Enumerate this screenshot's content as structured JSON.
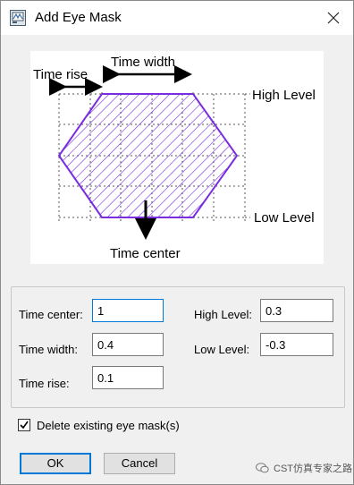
{
  "window": {
    "title": "Add Eye Mask"
  },
  "diagram": {
    "time_rise": "Time rise",
    "time_width": "Time width",
    "high_level": "High Level",
    "low_level": "Low Level",
    "time_center": "Time center",
    "mask_color": "#7a2ce0"
  },
  "fields": {
    "time_center": {
      "label": "Time center:",
      "value": "1"
    },
    "time_width": {
      "label": "Time width:",
      "value": "0.4"
    },
    "time_rise": {
      "label": "Time rise:",
      "value": "0.1"
    },
    "high_level": {
      "label": "High Level:",
      "value": "0.3"
    },
    "low_level": {
      "label": "Low Level:",
      "value": "-0.3"
    }
  },
  "delete_existing": {
    "label": "Delete existing eye mask(s)",
    "checked": true
  },
  "buttons": {
    "ok": "OK",
    "cancel": "Cancel"
  },
  "watermark": "CST仿真专家之路"
}
